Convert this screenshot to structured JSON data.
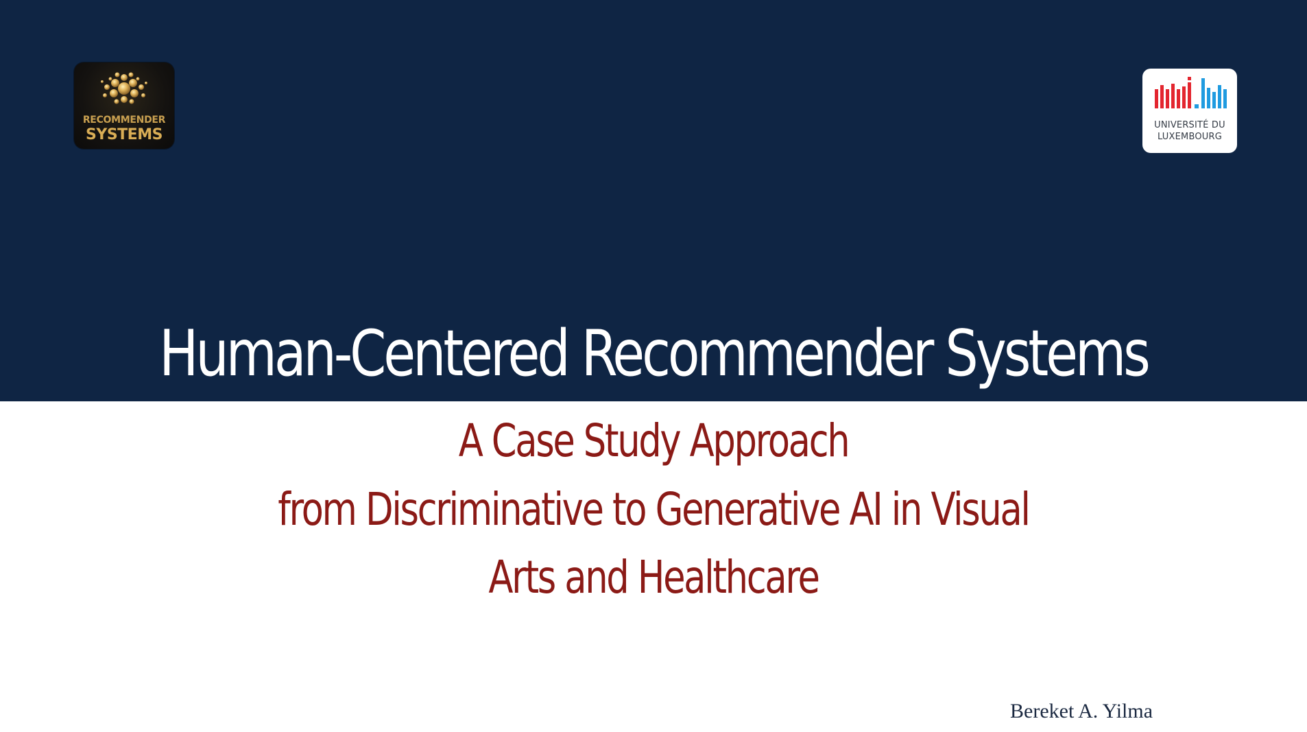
{
  "banner": {
    "title": "Human-Centered Recommender Systems",
    "background_color": "#0f2544"
  },
  "logo_left": {
    "icon": "golden-network-sphere-icon",
    "line1": "RECOMMENDER",
    "line2": "SYSTEMS",
    "text_color": "#c9a050"
  },
  "logo_right": {
    "mark": "uni.lu",
    "line1": "UNIVERSITÉ DU",
    "line2": "LUXEMBOURG",
    "mark_colors": [
      "#e3262f",
      "#1f9be0"
    ]
  },
  "subtitle": {
    "line1": "A Case Study Approach",
    "line2": "from Discriminative to Generative AI in Visual",
    "line3": "Arts and Healthcare",
    "color": "#8b1a16"
  },
  "author": "Bereket A. Yilma"
}
